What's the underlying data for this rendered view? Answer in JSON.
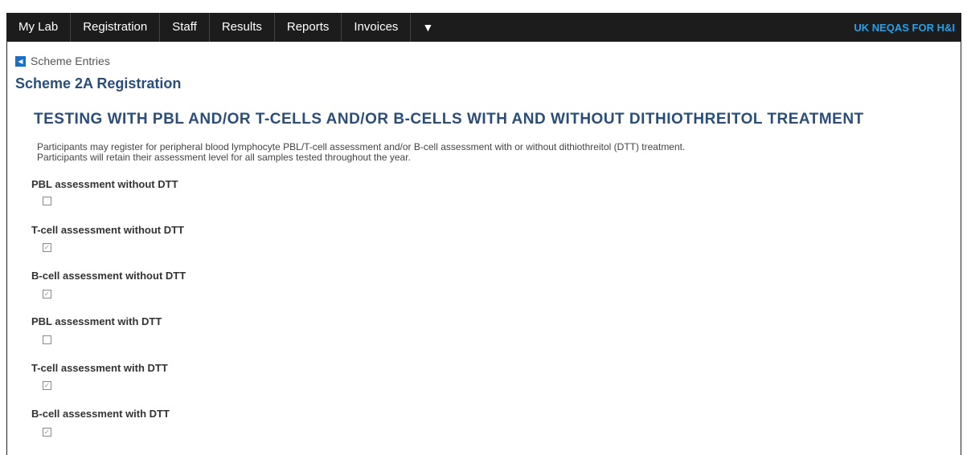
{
  "nav": {
    "items": [
      "My Lab",
      "Registration",
      "Staff",
      "Results",
      "Reports",
      "Invoices"
    ],
    "dropdown_glyph": "▼",
    "brand": "UK NEQAS FOR H&I"
  },
  "breadcrumb": {
    "label": "Scheme Entries",
    "icon": "back-arrow-icon"
  },
  "page": {
    "title": "Scheme 2A Registration",
    "section_heading": "TESTING WITH PBL AND/OR T-CELLS AND/OR B-CELLS WITH AND WITHOUT DITHIOTHREITOL TREATMENT",
    "intro_line1": "Participants may register for peripheral blood lymphocyte PBL/T-cell assessment and/or B-cell assessment with or without dithiothreitol (DTT) treatment.",
    "intro_line2": "Participants will retain their assessment level for all samples tested throughout the year."
  },
  "options": [
    {
      "label": "PBL assessment without DTT",
      "checked": false
    },
    {
      "label": "T-cell assessment without DTT",
      "checked": true
    },
    {
      "label": "B-cell assessment without DTT",
      "checked": true
    },
    {
      "label": "PBL assessment with DTT",
      "checked": false
    },
    {
      "label": "T-cell assessment with DTT",
      "checked": true
    },
    {
      "label": "B-cell assessment with DTT",
      "checked": true
    }
  ],
  "colors": {
    "nav_bg": "#1c1c1c",
    "brand": "#29a0e6",
    "title": "#2a4d7a"
  }
}
